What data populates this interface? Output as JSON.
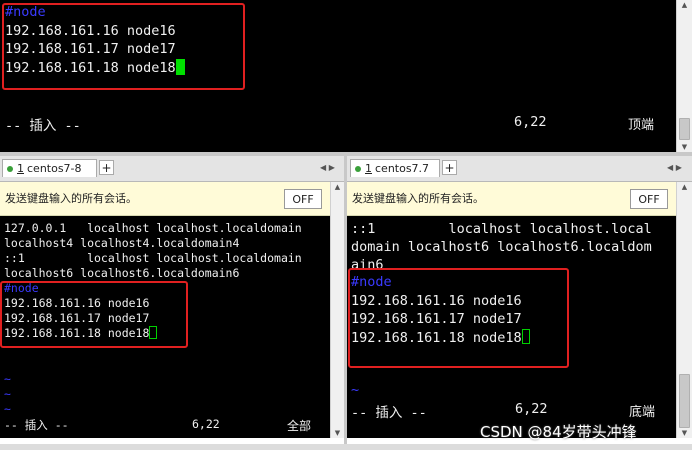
{
  "top_pane": {
    "lines": [
      "#node",
      "192.168.161.16 node16",
      "192.168.161.17 node17",
      "192.168.161.18 node18"
    ],
    "status_mode": "-- 插入 --",
    "status_pos": "6,22",
    "status_scroll": "顶端"
  },
  "left_session": {
    "tab_number": "1",
    "tab_label": "centos7-8",
    "send_text": "发送键盘输入的所有会话。",
    "off_label": "OFF",
    "lines": [
      "127.0.0.1   localhost localhost.localdomain",
      "localhost4 localhost4.localdomain4",
      "::1         localhost localhost.localdomain",
      "localhost6 localhost6.localdomain6",
      "#node",
      "192.168.161.16 node16",
      "192.168.161.17 node17",
      "192.168.161.18 node18"
    ],
    "tildes": [
      "~",
      "~",
      "~"
    ],
    "status_mode": "-- 插入 --",
    "status_pos": "6,22",
    "status_scroll": "全部"
  },
  "right_session": {
    "tab_number": "1",
    "tab_label": "centos7.7",
    "send_text": "发送键盘输入的所有会话。",
    "off_label": "OFF",
    "lines": [
      "::1         localhost localhost.local",
      "domain localhost6 localhost6.localdom",
      "ain6",
      "#node",
      "192.168.161.16 node16",
      "192.168.161.17 node17",
      "192.168.161.18 node18"
    ],
    "tildes": [
      "~"
    ],
    "status_mode": "-- 插入 --",
    "status_pos": "6,22",
    "status_scroll": "底端"
  },
  "watermark": "CSDN @84岁带头冲锋",
  "colors": {
    "terminal_bg": "#000000",
    "highlight": "#e02020",
    "cursor": "#00e000",
    "comment": "#3a3aff"
  }
}
